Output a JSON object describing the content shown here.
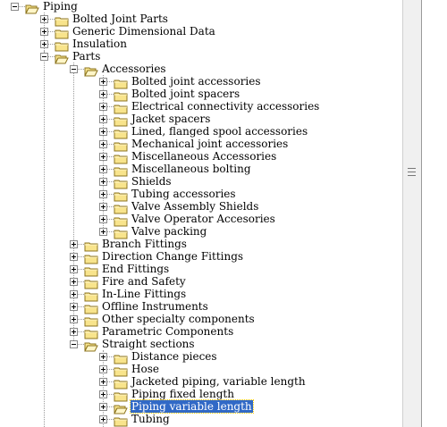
{
  "tree": [
    {
      "label": "Piping",
      "depth": 0,
      "state": "expanded"
    },
    {
      "label": "Bolted Joint Parts",
      "depth": 1,
      "state": "collapsed"
    },
    {
      "label": "Generic Dimensional Data",
      "depth": 1,
      "state": "collapsed"
    },
    {
      "label": "Insulation",
      "depth": 1,
      "state": "collapsed"
    },
    {
      "label": "Parts",
      "depth": 1,
      "state": "expanded"
    },
    {
      "label": "Accessories",
      "depth": 2,
      "state": "expanded"
    },
    {
      "label": "Bolted joint accessories",
      "depth": 3,
      "state": "collapsed"
    },
    {
      "label": "Bolted joint spacers",
      "depth": 3,
      "state": "collapsed"
    },
    {
      "label": "Electrical connectivity accessories",
      "depth": 3,
      "state": "collapsed"
    },
    {
      "label": "Jacket spacers",
      "depth": 3,
      "state": "collapsed"
    },
    {
      "label": "Lined, flanged spool accessories",
      "depth": 3,
      "state": "collapsed"
    },
    {
      "label": "Mechanical joint accessories",
      "depth": 3,
      "state": "collapsed"
    },
    {
      "label": "Miscellaneous Accessories",
      "depth": 3,
      "state": "collapsed"
    },
    {
      "label": "Miscellaneous bolting",
      "depth": 3,
      "state": "collapsed"
    },
    {
      "label": "Shields",
      "depth": 3,
      "state": "collapsed"
    },
    {
      "label": "Tubing accessories",
      "depth": 3,
      "state": "collapsed"
    },
    {
      "label": "Valve Assembly Shields",
      "depth": 3,
      "state": "collapsed"
    },
    {
      "label": "Valve Operator Accesories",
      "depth": 3,
      "state": "collapsed"
    },
    {
      "label": "Valve packing",
      "depth": 3,
      "state": "collapsed"
    },
    {
      "label": "Branch Fittings",
      "depth": 2,
      "state": "collapsed"
    },
    {
      "label": "Direction Change Fittings",
      "depth": 2,
      "state": "collapsed"
    },
    {
      "label": "End Fittings",
      "depth": 2,
      "state": "collapsed"
    },
    {
      "label": "Fire and Safety",
      "depth": 2,
      "state": "collapsed"
    },
    {
      "label": "In-Line Fittings",
      "depth": 2,
      "state": "collapsed"
    },
    {
      "label": "Offline Instruments",
      "depth": 2,
      "state": "collapsed"
    },
    {
      "label": "Other specialty components",
      "depth": 2,
      "state": "collapsed"
    },
    {
      "label": "Parametric Components",
      "depth": 2,
      "state": "collapsed"
    },
    {
      "label": "Straight sections",
      "depth": 2,
      "state": "expanded"
    },
    {
      "label": "Distance pieces",
      "depth": 3,
      "state": "collapsed"
    },
    {
      "label": "Hose",
      "depth": 3,
      "state": "collapsed"
    },
    {
      "label": "Jacketed piping, variable length",
      "depth": 3,
      "state": "collapsed"
    },
    {
      "label": "Piping fixed length",
      "depth": 3,
      "state": "collapsed"
    },
    {
      "label": "Piping variable length",
      "depth": 3,
      "state": "collapsed",
      "selected": true,
      "open_folder": true
    },
    {
      "label": "Tubing",
      "depth": 3,
      "state": "collapsed"
    }
  ],
  "colors": {
    "folder_fill": "#f8e48c",
    "folder_edge": "#8c7420",
    "selection": "#3169c6"
  },
  "icons": {
    "folder": "folder-icon",
    "folder_open": "folder-open-icon",
    "expand": "expand-plus-icon",
    "collapse": "collapse-minus-icon",
    "grip": "grip-icon"
  }
}
